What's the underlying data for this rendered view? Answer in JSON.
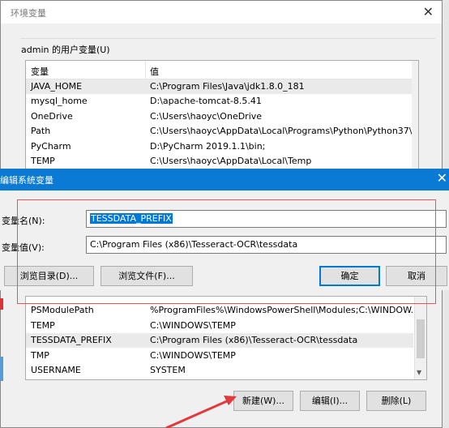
{
  "env_window": {
    "title": "环境变量",
    "user_group_label": "admin 的用户变量(U)",
    "columns": [
      "变量",
      "值"
    ],
    "user_vars": [
      {
        "name": "JAVA_HOME",
        "value": "C:\\Program Files\\Java\\jdk1.8.0_181"
      },
      {
        "name": "mysql_home",
        "value": "D:\\apache-tomcat-8.5.41"
      },
      {
        "name": "OneDrive",
        "value": "C:\\Users\\haoyc\\OneDrive"
      },
      {
        "name": "Path",
        "value": "C:\\Users\\haoyc\\AppData\\Local\\Programs\\Python\\Python37\\S..."
      },
      {
        "name": "PyCharm",
        "value": "D:\\PyCharm 2019.1.1\\bin;"
      },
      {
        "name": "TEMP",
        "value": "C:\\Users\\haoyc\\AppData\\Local\\Temp"
      }
    ],
    "system_vars": [
      {
        "name": "PSModulePath",
        "value": "%ProgramFiles%\\WindowsPowerShell\\Modules;C:\\WINDOW..."
      },
      {
        "name": "TEMP",
        "value": "C:\\WINDOWS\\TEMP"
      },
      {
        "name": "TESSDATA_PREFIX",
        "value": "C:\\Program Files (x86)\\Tesseract-OCR\\tessdata"
      },
      {
        "name": "TMP",
        "value": "C:\\WINDOWS\\TEMP"
      },
      {
        "name": "USERNAME",
        "value": "SYSTEM"
      }
    ],
    "buttons": {
      "new": "新建(W)...",
      "edit": "编辑(I)...",
      "delete": "删除(L)"
    }
  },
  "edit_dialog": {
    "title": "编辑系统变量",
    "name_label": "变量名(N):",
    "value_label": "变量值(V):",
    "name_value": "TESSDATA_PREFIX",
    "value_value": "C:\\Program Files (x86)\\Tesseract-OCR\\tessdata",
    "buttons": {
      "browse_dir": "浏览目录(D)...",
      "browse_file": "浏览文件(F)...",
      "ok": "确定",
      "cancel": "取消"
    }
  },
  "colors": {
    "dialog_title_bar": "#0a7ad4",
    "highlight_box": "#e8525a",
    "arrow": "#e03a3e",
    "selection": "#0078d7"
  },
  "icons": {
    "close": "close-icon",
    "scroll_down": "chevron-down-icon"
  }
}
